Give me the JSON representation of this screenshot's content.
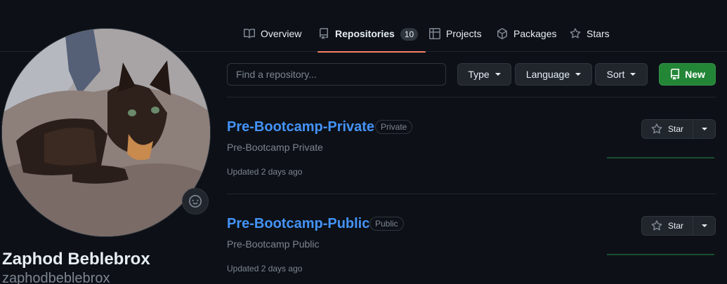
{
  "nav": {
    "tabs": [
      {
        "label": "Overview",
        "icon": "book-icon"
      },
      {
        "label": "Repositories",
        "icon": "repo-icon",
        "count": "10",
        "selected": true
      },
      {
        "label": "Projects",
        "icon": "table-icon"
      },
      {
        "label": "Packages",
        "icon": "package-icon"
      },
      {
        "label": "Stars",
        "icon": "star-icon"
      }
    ]
  },
  "profile": {
    "name": "Zaphod Beblebrox",
    "login": "zaphodbeblebrox"
  },
  "filters": {
    "search_placeholder": "Find a repository...",
    "type_label": "Type",
    "language_label": "Language",
    "sort_label": "Sort",
    "new_label": "New"
  },
  "repos": [
    {
      "name": "Pre-Bootcamp-Private",
      "visibility": "Private",
      "description": "Pre-Bootcamp Private",
      "updated": "Updated 2 days ago",
      "star_label": "Star"
    },
    {
      "name": "Pre-Bootcamp-Public",
      "visibility": "Public",
      "description": "Pre-Bootcamp Public",
      "updated": "Updated 2 days ago",
      "star_label": "Star"
    }
  ],
  "colors": {
    "accent_link": "#4493f8",
    "tab_underline": "#f78166",
    "new_button": "#238636"
  }
}
